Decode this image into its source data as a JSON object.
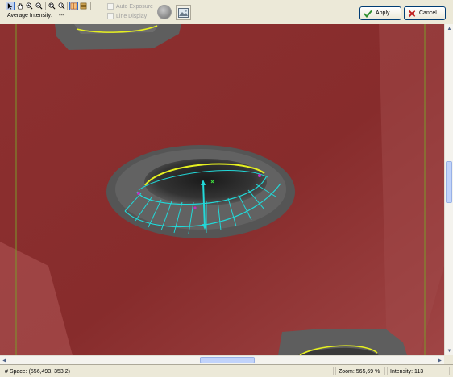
{
  "toolbar": {
    "tools": [
      {
        "name": "pointer-tool",
        "icon": "arrow-cursor-icon",
        "active": true
      },
      {
        "name": "pan-tool",
        "icon": "hand-icon"
      },
      {
        "name": "zoom-in-tool",
        "icon": "zoom-in-icon"
      },
      {
        "name": "zoom-out-tool",
        "icon": "zoom-out-icon"
      },
      {
        "name": "zoom-fit-tool",
        "icon": "zoom-fit-icon"
      },
      {
        "name": "zoom-actual-tool",
        "icon": "zoom-actual-icon"
      },
      {
        "name": "grid-tool",
        "icon": "grid-icon",
        "active": true
      },
      {
        "name": "overlay-tool",
        "icon": "overlay-icon"
      }
    ],
    "average_intensity_label": "Average Intensity:",
    "average_intensity_value": "---",
    "auto_exposure_label": "Auto Exposure",
    "line_display_label": "Line Display",
    "apply_label": "Apply",
    "cancel_label": "Cancel"
  },
  "status": {
    "space": "# Space: (556,493, 353,2)",
    "zoom": "Zoom: 565,69 %",
    "intensity": "Intensity: 113"
  },
  "colors": {
    "mask": "#8a2e2e",
    "contour_yellow": "#e6f020",
    "contour_cyan": "#22d8d8",
    "guide_line": "#7a9a2a",
    "apply_check": "#2f8f2f",
    "cancel_x": "#c02020"
  }
}
